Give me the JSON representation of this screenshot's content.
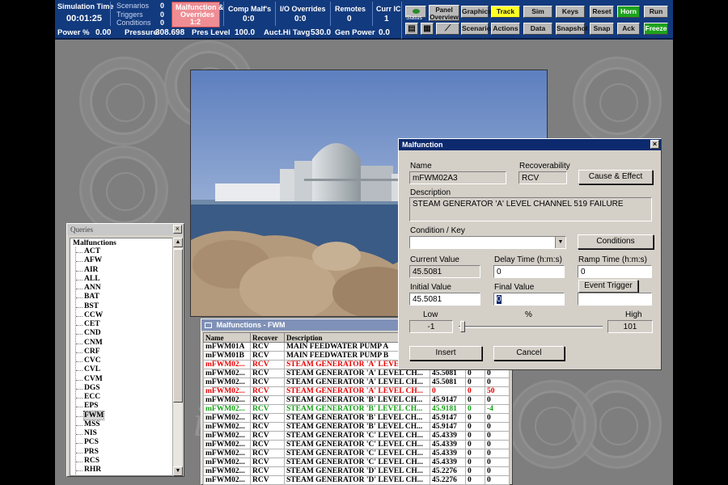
{
  "status": {
    "sim_time_label": "Simulation Time",
    "sim_time": "00:01:25",
    "scenarios_label": "Scenarios",
    "scenarios_count": "0",
    "triggers_label": "Triggers",
    "triggers_count": "0",
    "conditions_label": "Conditions",
    "conditions_count": "0",
    "malf_label_1": "Malfunction &",
    "malf_label_2": "Overrides",
    "malf_count": "1:2",
    "comp_malfs_label": "Comp Malf's",
    "comp_malfs": "0:0",
    "io_label": "I/O Overrides",
    "io_value": "0:0",
    "remotes_label": "Remotes",
    "remotes": "0",
    "curr_ic_label": "Curr IC",
    "curr_ic": "1",
    "power_label": "Power %",
    "power": "0.00",
    "pressure_label": "Pressure",
    "pressure": "308.698",
    "pres_level_label": "Pres Level",
    "pres_level": "100.0",
    "tavg_label": "Auct.Hi Tavg",
    "tavg": "530.0",
    "gen_power_label": "Gen Power",
    "gen_power": "0.0"
  },
  "toolbar": {
    "status": "Status",
    "panel_overview_1": "Panel",
    "panel_overview_2": "Overview",
    "graphics": "Graphics",
    "track": "Track",
    "sim": "Sim",
    "keys": "Keys",
    "reset": "Reset",
    "horn": "Horn",
    "run": "Run",
    "scenario": "Scenario",
    "actions": "Actions",
    "data": "Data",
    "snapshot": "Snapshot",
    "snap": "Snap",
    "ack": "Ack",
    "freeze": "Freeze"
  },
  "watermark": "ion",
  "queries": {
    "title": "Queries",
    "root": "Malfunctions",
    "items": [
      "ACT",
      "AFW",
      "AIR",
      "ALL",
      "ANN",
      "BAT",
      "BST",
      "CCW",
      "CET",
      "CND",
      "CNM",
      "CRF",
      "CVC",
      "CVL",
      "CVM",
      "DGS",
      "ECC",
      "EPS",
      "FWM",
      "MSS",
      "NIS",
      "PCS",
      "PRS",
      "RCS",
      "RHR"
    ],
    "selected": "FWM"
  },
  "fwm": {
    "title": "Malfunctions - FWM",
    "headers": [
      "Name",
      "Recover",
      "Description",
      "",
      "",
      " "
    ],
    "rows": [
      {
        "name": "mFWM01A",
        "rec": "RCV",
        "desc": "MAIN FEEDWATER PUMP A",
        "v1": "",
        "v2": "",
        "v3": "",
        "style": ""
      },
      {
        "name": "mFWM01B",
        "rec": "RCV",
        "desc": "MAIN FEEDWATER PUMP B",
        "v1": "",
        "v2": "",
        "v3": "",
        "style": ""
      },
      {
        "name": "mFWM02...",
        "rec": "RCV",
        "desc": "STEAM GENERATOR 'A' LEVEL CH...",
        "v1": "",
        "v2": "",
        "v3": "",
        "style": "red"
      },
      {
        "name": "mFWM02...",
        "rec": "RCV",
        "desc": "STEAM GENERATOR 'A' LEVEL CH...",
        "v1": "45.5081",
        "v2": "0",
        "v3": "0",
        "style": ""
      },
      {
        "name": "mFWM02...",
        "rec": "RCV",
        "desc": "STEAM GENERATOR 'A' LEVEL CH...",
        "v1": "45.5081",
        "v2": "0",
        "v3": "0",
        "style": ""
      },
      {
        "name": "mFWM02...",
        "rec": "RCV",
        "desc": "STEAM GENERATOR 'A' LEVEL CH...",
        "v1": "0",
        "v2": "0",
        "v3": "50",
        "style": "red"
      },
      {
        "name": "mFWM02...",
        "rec": "RCV",
        "desc": "STEAM GENERATOR 'B' LEVEL CH...",
        "v1": "45.9147",
        "v2": "0",
        "v3": "0",
        "style": ""
      },
      {
        "name": "mFWM02...",
        "rec": "RCV",
        "desc": "STEAM GENERATOR 'B' LEVEL CH...",
        "v1": "45.9181",
        "v2": "0",
        "v3": "-4",
        "style": "green"
      },
      {
        "name": "mFWM02...",
        "rec": "RCV",
        "desc": "STEAM GENERATOR 'B' LEVEL CH...",
        "v1": "45.9147",
        "v2": "0",
        "v3": "0",
        "style": ""
      },
      {
        "name": "mFWM02...",
        "rec": "RCV",
        "desc": "STEAM GENERATOR 'B' LEVEL CH...",
        "v1": "45.9147",
        "v2": "0",
        "v3": "0",
        "style": ""
      },
      {
        "name": "mFWM02...",
        "rec": "RCV",
        "desc": "STEAM GENERATOR 'C' LEVEL CH...",
        "v1": "45.4339",
        "v2": "0",
        "v3": "0",
        "style": ""
      },
      {
        "name": "mFWM02...",
        "rec": "RCV",
        "desc": "STEAM GENERATOR 'C' LEVEL CH...",
        "v1": "45.4339",
        "v2": "0",
        "v3": "0",
        "style": ""
      },
      {
        "name": "mFWM02...",
        "rec": "RCV",
        "desc": "STEAM GENERATOR 'C' LEVEL CH...",
        "v1": "45.4339",
        "v2": "0",
        "v3": "0",
        "style": ""
      },
      {
        "name": "mFWM02...",
        "rec": "RCV",
        "desc": "STEAM GENERATOR 'C' LEVEL CH...",
        "v1": "45.4339",
        "v2": "0",
        "v3": "0",
        "style": ""
      },
      {
        "name": "mFWM02...",
        "rec": "RCV",
        "desc": "STEAM GENERATOR 'D' LEVEL CH...",
        "v1": "45.2276",
        "v2": "0",
        "v3": "0",
        "style": ""
      },
      {
        "name": "mFWM02...",
        "rec": "RCV",
        "desc": "STEAM GENERATOR 'D' LEVEL CH...",
        "v1": "45.2276",
        "v2": "0",
        "v3": "0",
        "style": ""
      },
      {
        "name": "mFWM02...",
        "rec": "RCV",
        "desc": "STEAM GENERATOR 'D' LEVEL CH...",
        "v1": "45.2276",
        "v2": "0",
        "v3": "0",
        "style": ""
      }
    ]
  },
  "dialog": {
    "title": "Malfunction",
    "name_label": "Name",
    "name": "mFWM02A3",
    "recover_label": "Recoverability",
    "recover": "RCV",
    "cause_effect": "Cause & Effect",
    "desc_label": "Description",
    "desc": "STEAM GENERATOR 'A' LEVEL CHANNEL 519 FAILURE",
    "cond_label": "Condition / Key",
    "cond_value": "",
    "conditions_btn": "Conditions",
    "current_label": "Current Value",
    "current": "45.5081",
    "delay_label": "Delay Time (h:m:s)",
    "delay": "0",
    "ramp_label": "Ramp Time (h:m:s)",
    "ramp": "0",
    "initial_label": "Initial Value",
    "initial": "45.5081",
    "final_label": "Final Value",
    "final": "0",
    "event_trigger": "Event Trigger",
    "event_value": "",
    "low_label": "Low",
    "low": "-1",
    "pct_label": "%",
    "high_label": "High",
    "high": "101",
    "insert": "Insert",
    "cancel": "Cancel"
  }
}
